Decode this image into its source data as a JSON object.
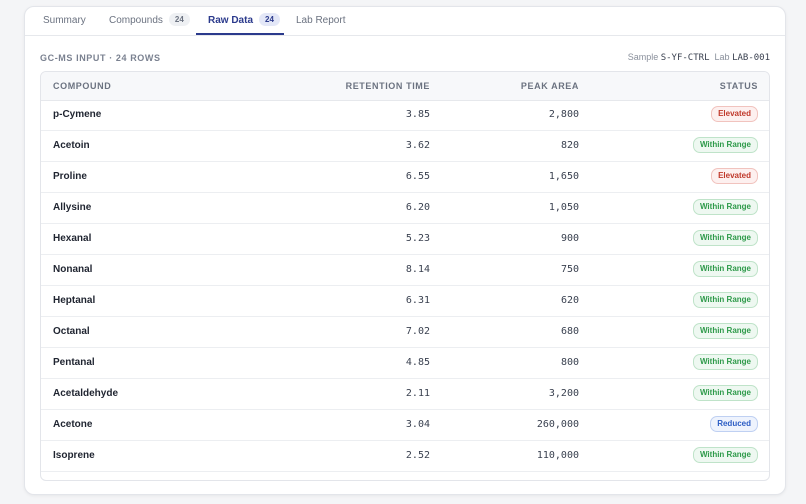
{
  "tabs": [
    {
      "label": "Summary",
      "count": null,
      "active": false
    },
    {
      "label": "Compounds",
      "count": "24",
      "active": false
    },
    {
      "label": "Raw Data",
      "count": "24",
      "active": true
    },
    {
      "label": "Lab Report",
      "count": null,
      "active": false
    }
  ],
  "meta": {
    "input_label": "GC-MS INPUT · 24 ROWS",
    "sample_label": "Sample",
    "sample_value": "S-YF-CTRL",
    "lab_label": "Lab",
    "lab_value": "LAB-001"
  },
  "table": {
    "headers": {
      "compound": "COMPOUND",
      "retention_time": "RETENTION TIME",
      "peak_area": "PEAK AREA",
      "status": "STATUS"
    },
    "rows": [
      {
        "compound": "p-Cymene",
        "retention_time": "3.85",
        "peak_area": "2,800",
        "status": "Elevated",
        "status_kind": "elevated"
      },
      {
        "compound": "Acetoin",
        "retention_time": "3.62",
        "peak_area": "820",
        "status": "Within Range",
        "status_kind": "within"
      },
      {
        "compound": "Proline",
        "retention_time": "6.55",
        "peak_area": "1,650",
        "status": "Elevated",
        "status_kind": "elevated"
      },
      {
        "compound": "Allysine",
        "retention_time": "6.20",
        "peak_area": "1,050",
        "status": "Within Range",
        "status_kind": "within"
      },
      {
        "compound": "Hexanal",
        "retention_time": "5.23",
        "peak_area": "900",
        "status": "Within Range",
        "status_kind": "within"
      },
      {
        "compound": "Nonanal",
        "retention_time": "8.14",
        "peak_area": "750",
        "status": "Within Range",
        "status_kind": "within"
      },
      {
        "compound": "Heptanal",
        "retention_time": "6.31",
        "peak_area": "620",
        "status": "Within Range",
        "status_kind": "within"
      },
      {
        "compound": "Octanal",
        "retention_time": "7.02",
        "peak_area": "680",
        "status": "Within Range",
        "status_kind": "within"
      },
      {
        "compound": "Pentanal",
        "retention_time": "4.85",
        "peak_area": "800",
        "status": "Within Range",
        "status_kind": "within"
      },
      {
        "compound": "Acetaldehyde",
        "retention_time": "2.11",
        "peak_area": "3,200",
        "status": "Within Range",
        "status_kind": "within"
      },
      {
        "compound": "Acetone",
        "retention_time": "3.04",
        "peak_area": "260,000",
        "status": "Reduced",
        "status_kind": "reduced"
      },
      {
        "compound": "Isoprene",
        "retention_time": "2.52",
        "peak_area": "110,000",
        "status": "Within Range",
        "status_kind": "within"
      },
      {
        "compound": "",
        "retention_time": "",
        "peak_area": "",
        "status": "",
        "status_kind": "within"
      }
    ]
  },
  "colors": {
    "accent": "#2b3a8c",
    "within": "#2e9a4a",
    "elevated": "#c0392b",
    "reduced": "#2b5cc4"
  }
}
